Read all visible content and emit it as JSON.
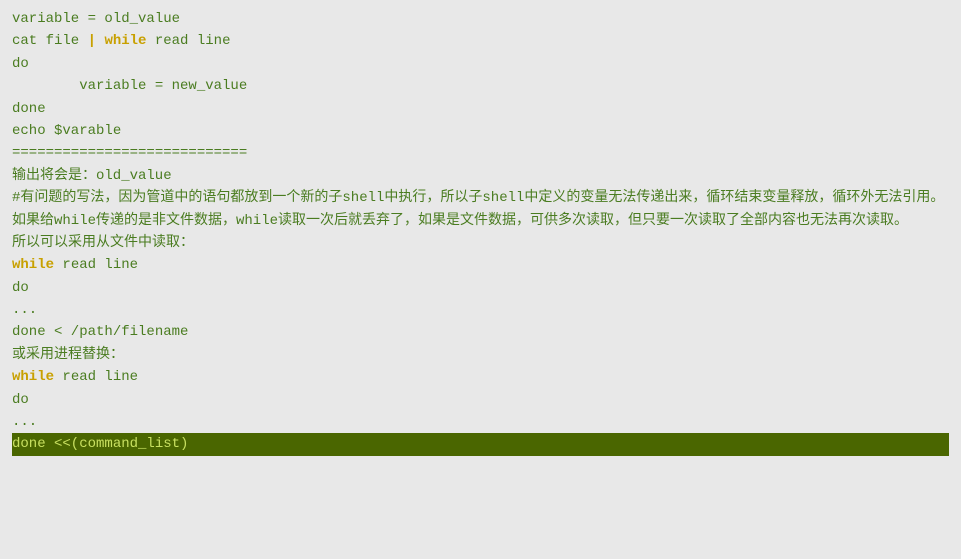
{
  "content": {
    "lines": [
      {
        "id": "l1",
        "type": "code",
        "parts": [
          {
            "text": "variable = old_value",
            "style": "normal"
          }
        ]
      },
      {
        "id": "l2",
        "type": "code",
        "parts": [
          {
            "text": "cat file ",
            "style": "normal"
          },
          {
            "text": "|",
            "style": "pipe"
          },
          {
            "text": " ",
            "style": "normal"
          },
          {
            "text": "while",
            "style": "keyword"
          },
          {
            "text": " read line",
            "style": "normal"
          }
        ]
      },
      {
        "id": "l3",
        "type": "code",
        "parts": [
          {
            "text": "do",
            "style": "normal"
          }
        ]
      },
      {
        "id": "l4",
        "type": "code",
        "parts": [
          {
            "text": "        variable = new_value",
            "style": "normal"
          }
        ]
      },
      {
        "id": "l5",
        "type": "code",
        "parts": [
          {
            "text": "done",
            "style": "normal"
          }
        ]
      },
      {
        "id": "l6",
        "type": "code",
        "parts": [
          {
            "text": "echo $varable",
            "style": "normal"
          }
        ]
      },
      {
        "id": "l7",
        "type": "divider",
        "parts": [
          {
            "text": "============================",
            "style": "divider"
          }
        ]
      },
      {
        "id": "l8",
        "type": "text",
        "parts": [
          {
            "text": "输出将会是：old_value",
            "style": "normal"
          }
        ]
      },
      {
        "id": "l9",
        "type": "text",
        "parts": [
          {
            "text": "#有问题的写法，因为管道中的语句都放到一个新的子shell中执行，所以子shell中定义的变量无法传递出来，循环结束变量释放，循环外无法引用。",
            "style": "normal"
          }
        ]
      },
      {
        "id": "l10",
        "type": "text",
        "parts": [
          {
            "text": " 如果给while传递的是非文件数据，while读取一次后就丢弃了，如果是文件数据，可供多次读取，但只要一次读取了全部内容也无法再次读取。",
            "style": "normal"
          }
        ]
      },
      {
        "id": "l11",
        "type": "text",
        "parts": [
          {
            "text": " 所以可以采用从文件中读取：",
            "style": "normal"
          }
        ]
      },
      {
        "id": "l12",
        "type": "code",
        "parts": [
          {
            "text": "while",
            "style": "keyword"
          },
          {
            "text": " read line",
            "style": "normal"
          }
        ]
      },
      {
        "id": "l13",
        "type": "code",
        "parts": [
          {
            "text": "do",
            "style": "normal"
          }
        ]
      },
      {
        "id": "l14",
        "type": "code",
        "parts": [
          {
            "text": "...",
            "style": "normal"
          }
        ]
      },
      {
        "id": "l15",
        "type": "code",
        "parts": [
          {
            "text": "done < /path/filename",
            "style": "normal"
          }
        ]
      },
      {
        "id": "l16",
        "type": "text",
        "parts": [
          {
            "text": "或采用进程替换：",
            "style": "normal"
          }
        ]
      },
      {
        "id": "l17",
        "type": "code",
        "parts": [
          {
            "text": "while",
            "style": "keyword"
          },
          {
            "text": " read line",
            "style": "normal"
          }
        ]
      },
      {
        "id": "l18",
        "type": "code",
        "parts": [
          {
            "text": "do",
            "style": "normal"
          }
        ]
      },
      {
        "id": "l19",
        "type": "code",
        "parts": [
          {
            "text": "...",
            "style": "normal"
          }
        ]
      },
      {
        "id": "l20",
        "type": "highlight",
        "parts": [
          {
            "text": "done <<(command_list)",
            "style": "highlight"
          }
        ]
      }
    ]
  }
}
